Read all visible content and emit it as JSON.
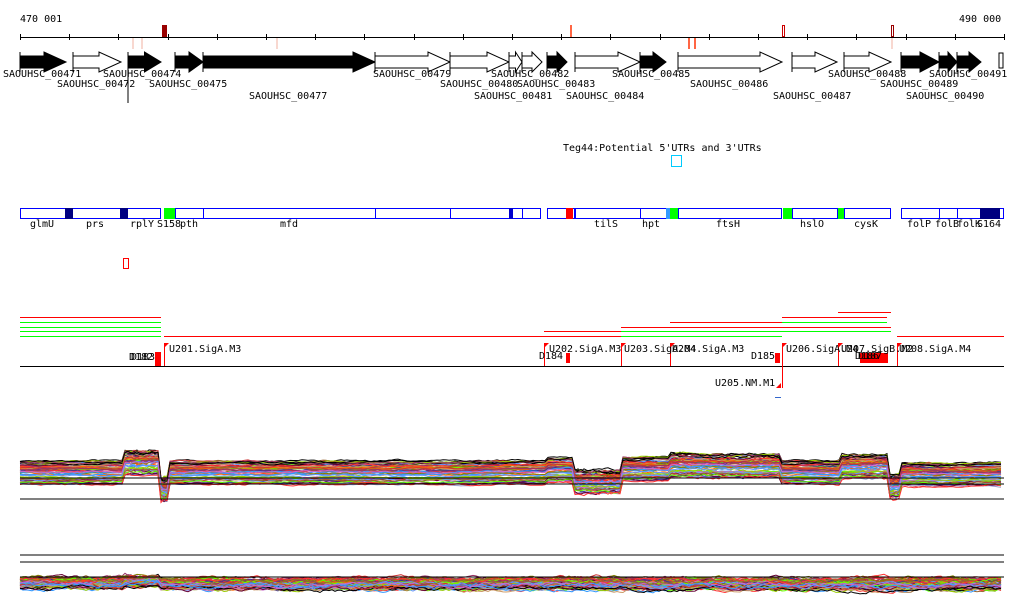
{
  "scale": {
    "start_label": "470 001",
    "end_label": "490 000"
  },
  "genes": [
    {
      "label": "SAOUHSC_00471",
      "strand": "filled"
    },
    {
      "label": "SAOUHSC_00472",
      "strand": "hollow"
    },
    {
      "label": "SAOUHSC_00474",
      "strand": "filled"
    },
    {
      "label": "SAOUHSC_00475",
      "strand": "filled"
    },
    {
      "label": "SAOUHSC_00477",
      "strand": "filled"
    },
    {
      "label": "SAOUHSC_00479",
      "strand": "hollow"
    },
    {
      "label": "SAOUHSC_00480",
      "strand": "hollow"
    },
    {
      "label": "SAOUHSC_00481",
      "strand": "hollow"
    },
    {
      "label": "SAOUHSC_00483",
      "strand": "hollow"
    },
    {
      "label": "SAOUHSC_00482",
      "strand": "filled"
    },
    {
      "label": "SAOUHSC_00484",
      "strand": "hollow"
    },
    {
      "label": "SAOUHSC_00485",
      "strand": "filled"
    },
    {
      "label": "SAOUHSC_00486",
      "strand": "hollow"
    },
    {
      "label": "SAOUHSC_00487",
      "strand": "hollow"
    },
    {
      "label": "SAOUHSC_00488",
      "strand": "hollow"
    },
    {
      "label": "SAOUHSC_00489",
      "strand": "filled"
    },
    {
      "label": "SAOUHSC_00490",
      "strand": "filled"
    },
    {
      "label": "SAOUHSC_00491",
      "strand": "filled"
    }
  ],
  "teg_track": {
    "label": "Teg44:Potential 5'UTRs and 3'UTRs"
  },
  "annotations": [
    "glmU",
    "prs",
    "rplY",
    "S158",
    "pth",
    "mfd",
    "tilS",
    "hpt",
    "ftsH",
    "hslO",
    "cysK",
    "folP",
    "folB",
    "folK",
    "S164"
  ],
  "transcripts": [
    {
      "label": "D182"
    },
    {
      "label": "D183"
    },
    {
      "label": "U201.SigA.M3"
    },
    {
      "label": "D184"
    },
    {
      "label": "U202.SigA.M3"
    },
    {
      "label": "U203.SigA.M4"
    },
    {
      "label": "U204.SigA.M3"
    },
    {
      "label": "D185"
    },
    {
      "label": "U206.SigA.M4"
    },
    {
      "label": "U207.SigB.M2"
    },
    {
      "label": "D186"
    },
    {
      "label": "D187"
    },
    {
      "label": "U208.SigA.M4"
    },
    {
      "label": "U205.NM.M1"
    }
  ],
  "colors": {
    "annotation_border": "#0000ff",
    "transcript": "#ff0000",
    "condition_green": "#00ff00",
    "expression_palette": [
      "#000000",
      "#808000",
      "#ff6600",
      "#99cc00",
      "#66ff00",
      "#cc3333",
      "#993366",
      "#6699ff",
      "#3399ff",
      "#cc66cc",
      "#ff3333",
      "#996633",
      "#9999cc",
      "#333399",
      "#cc9966",
      "#660033"
    ]
  }
}
